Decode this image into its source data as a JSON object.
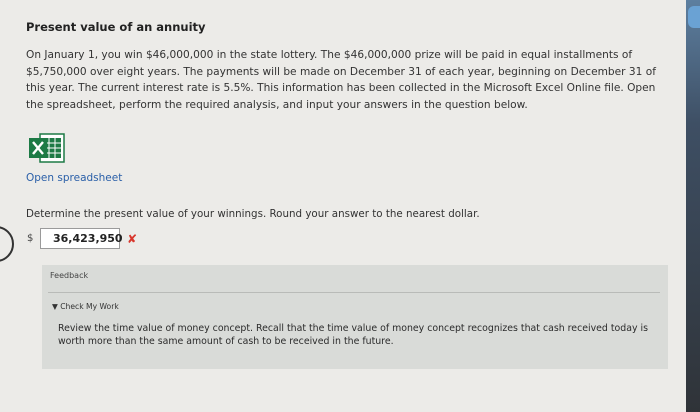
{
  "title": "Present value of an annuity",
  "paragraph": "On January 1, you win $46,000,000 in the state lottery. The $46,000,000 prize will be paid in equal installments of $5,750,000 over eight years. The payments will be made on December 31 of each year, beginning on December 31 of this year. The current interest rate is 5.5%. This information has been collected in the Microsoft Excel Online file. Open the spreadsheet, perform the required analysis, and input your answers in the question below.",
  "spreadsheet": {
    "icon": "excel-icon",
    "link_label": "Open spreadsheet"
  },
  "question": "Determine the present value of your winnings. Round your answer to the nearest dollar.",
  "answer": {
    "currency_symbol": "$",
    "value": "36,423,950",
    "status_mark": "✘"
  },
  "feedback": {
    "label": "Feedback",
    "check_label": "▼ Check My Work",
    "text": "Review the time value of money concept. Recall that the time value of money concept recognizes that cash received today is worth more than the same amount of cash to be received in the future."
  },
  "colors": {
    "link": "#2a5fa8",
    "wrong": "#d8362c",
    "excel_green": "#1d7a45"
  }
}
